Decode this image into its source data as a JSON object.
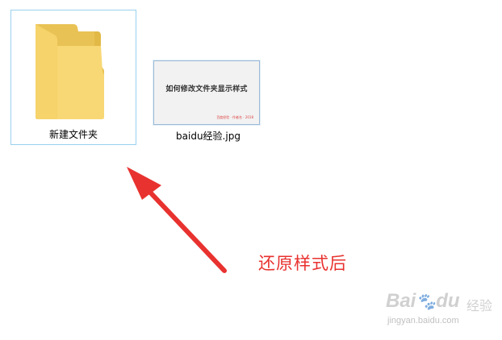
{
  "desktop": {
    "items": [
      {
        "label": "新建文件夹",
        "type": "folder",
        "selected": true
      },
      {
        "label": "baidu经验.jpg",
        "type": "image",
        "thumbnail": {
          "title": "如何修改文件夹显示样式",
          "signature": "百度经验 · 作者名 · 2018"
        }
      }
    ]
  },
  "annotation": {
    "text": "还原样式后",
    "color": "#e8322f"
  },
  "watermark": {
    "logo": "Bai",
    "logo_rest": "du",
    "sub": "经验",
    "url": "jingyan.baidu.com"
  },
  "colors": {
    "selection_border": "#99d1ef",
    "folder": "#f8d775",
    "arrow": "#e8322f"
  }
}
